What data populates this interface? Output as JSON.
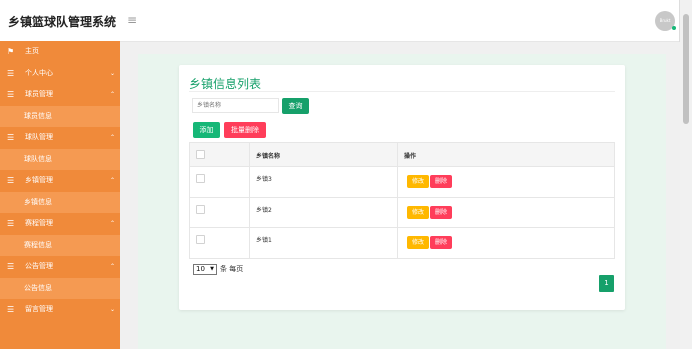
{
  "header": {
    "title": "乡镇篮球队管理系统",
    "menu_icon": "hamburger-icon",
    "avatar_text": "Brukt"
  },
  "sidebar": {
    "items": [
      {
        "label": "主页",
        "icon": "flag-icon",
        "type": "group",
        "chevron": ""
      },
      {
        "label": "个人中心",
        "icon": "list-icon",
        "type": "group",
        "chevron": "⌄"
      },
      {
        "label": "球员管理",
        "icon": "list-icon",
        "type": "group",
        "chevron": "⌃"
      },
      {
        "label": "球员信息",
        "type": "sub"
      },
      {
        "label": "球队管理",
        "icon": "list-icon",
        "type": "group",
        "chevron": "⌃"
      },
      {
        "label": "球队信息",
        "type": "sub"
      },
      {
        "label": "乡镇管理",
        "icon": "list-icon",
        "type": "group",
        "chevron": "⌃"
      },
      {
        "label": "乡镇信息",
        "type": "sub"
      },
      {
        "label": "赛程管理",
        "icon": "list-icon",
        "type": "group",
        "chevron": "⌃"
      },
      {
        "label": "赛程信息",
        "type": "sub"
      },
      {
        "label": "公告管理",
        "icon": "list-icon",
        "type": "group",
        "chevron": "⌃"
      },
      {
        "label": "公告信息",
        "type": "sub"
      },
      {
        "label": "留言管理",
        "icon": "list-icon",
        "type": "group",
        "chevron": "⌄"
      }
    ]
  },
  "main": {
    "card_title": "乡镇信息列表",
    "search": {
      "placeholder": "乡镇名称",
      "value": "",
      "button_label": "查询"
    },
    "toolbar": {
      "add_label": "添加",
      "batch_delete_label": "批量删除"
    },
    "table": {
      "headers": {
        "name": "乡镇名称",
        "actions": "操作"
      },
      "rows": [
        {
          "name": "乡镇3",
          "edit_label": "修改",
          "delete_label": "删除"
        },
        {
          "name": "乡镇2",
          "edit_label": "修改",
          "delete_label": "删除"
        },
        {
          "name": "乡镇1",
          "edit_label": "修改",
          "delete_label": "删除"
        }
      ]
    },
    "pagination": {
      "page_size": "10",
      "page_size_label": "条 每页",
      "current_page": "1"
    }
  },
  "colors": {
    "sidebar": "#f08a3a",
    "sidebar_sub": "#f59a52",
    "primary_green": "#16a06a",
    "add_green": "#16b777",
    "danger": "#ff3d5a",
    "warning": "#ffb800"
  }
}
